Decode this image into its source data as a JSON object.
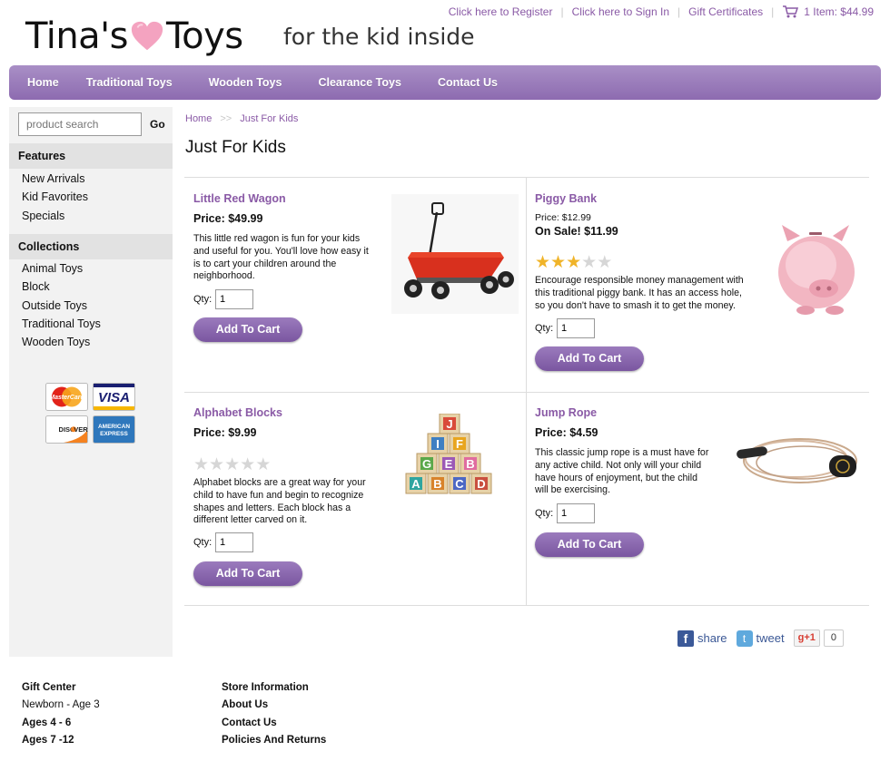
{
  "header": {
    "logo_left": "Tina's",
    "logo_right": "Toys",
    "tagline": "for the kid inside",
    "links": [
      "Click here to Register",
      "Click here to Sign In",
      "Gift Certificates"
    ],
    "cart_text": "1 Item: $44.99"
  },
  "nav": [
    "Home",
    "Traditional Toys",
    "Wooden Toys",
    "Clearance Toys",
    "Contact Us"
  ],
  "sidebar": {
    "search_placeholder": "product search",
    "go_label": "Go",
    "features_heading": "Features",
    "features": [
      "New Arrivals",
      "Kid Favorites",
      "Specials"
    ],
    "collections_heading": "Collections",
    "collections": [
      "Animal Toys",
      "Block",
      "Outside Toys",
      "Traditional Toys",
      "Wooden Toys"
    ],
    "payment_cards": [
      "MasterCard",
      "VISA",
      "DISCOVER",
      "AMERICAN EXPRESS"
    ]
  },
  "breadcrumb": [
    "Home",
    "Just For Kids"
  ],
  "page_title": "Just For Kids",
  "products": [
    {
      "name": "Little Red Wagon",
      "price": "Price: $49.99",
      "description": "This little red wagon is fun for your kids and useful for you. You'll love how easy it is to cart your children around the neighborhood.",
      "qty_label": "Qty:",
      "qty": "1",
      "button": "Add To Cart"
    },
    {
      "name": "Piggy Bank",
      "old_price": "Price: $12.99",
      "price": "On Sale! $11.99",
      "rating": 3,
      "rating_max": 5,
      "description": "Encourage responsible money management with this traditional piggy bank. It has an access hole, so you don't have to smash it to get the money.",
      "qty_label": "Qty:",
      "qty": "1",
      "button": "Add To Cart"
    },
    {
      "name": "Alphabet Blocks",
      "price": "Price: $9.99",
      "rating": 0,
      "rating_max": 5,
      "description": "Alphabet blocks are a great way for your child to have fun and begin to recognize shapes and letters. Each block has a different letter carved on it.",
      "qty_label": "Qty:",
      "qty": "1",
      "button": "Add To Cart",
      "block_letters": [
        "J",
        "I",
        "F",
        "G",
        "E",
        "B",
        "A",
        "B",
        "C",
        "D"
      ]
    },
    {
      "name": "Jump Rope",
      "price": "Price: $4.59",
      "description": "This classic jump rope is a must have for any active child. Not only will your child have hours of enjoyment, but the child will be exercising.",
      "qty_label": "Qty:",
      "qty": "1",
      "button": "Add To Cart"
    }
  ],
  "share": {
    "facebook": "share",
    "twitter": "tweet",
    "gplus": "+1",
    "gplus_count": "0"
  },
  "footer": {
    "col1": [
      "Gift Center",
      "Newborn - Age 3",
      "Ages 4 - 6",
      "Ages 7 -12"
    ],
    "col2": [
      "Store Information",
      "About Us",
      "Contact Us",
      "Policies And Returns"
    ]
  },
  "colors": {
    "accent": "#8a5aa6",
    "nav": "#9a7bbd",
    "button": "#8763ac",
    "star": "#f0b429",
    "heart": "#f4a3c0"
  }
}
